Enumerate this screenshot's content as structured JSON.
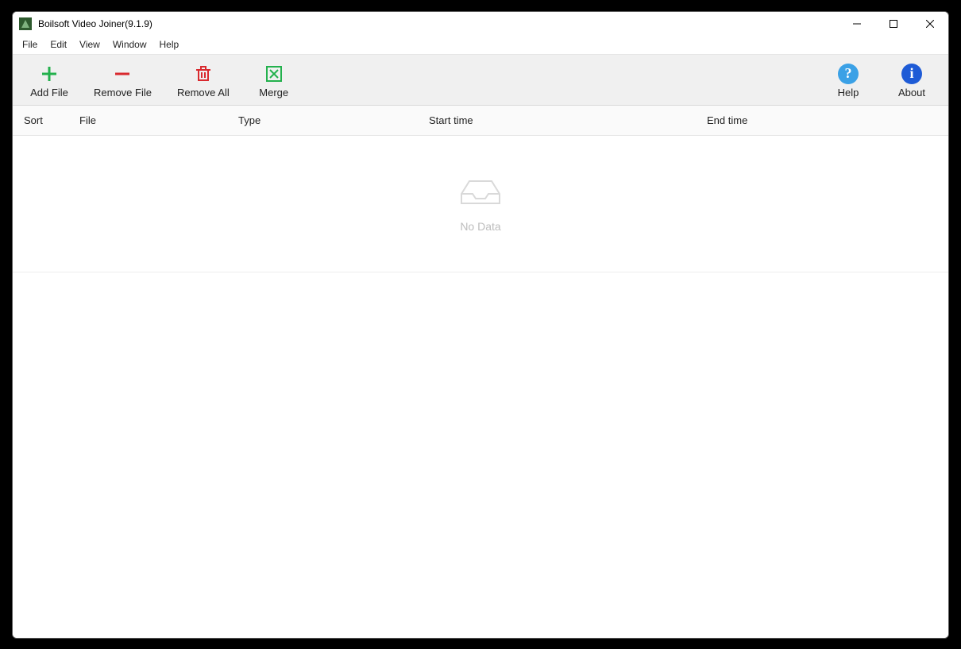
{
  "titlebar": {
    "title": "Boilsoft Video Joiner(9.1.9)"
  },
  "menubar": {
    "items": [
      "File",
      "Edit",
      "View",
      "Window",
      "Help"
    ]
  },
  "toolbar": {
    "add_file_label": "Add File",
    "remove_file_label": "Remove File",
    "remove_all_label": "Remove All",
    "merge_label": "Merge",
    "help_label": "Help",
    "about_label": "About"
  },
  "columns": {
    "sort": "Sort",
    "file": "File",
    "type": "Type",
    "start": "Start time",
    "end": "End time"
  },
  "content": {
    "nodata": "No Data"
  }
}
